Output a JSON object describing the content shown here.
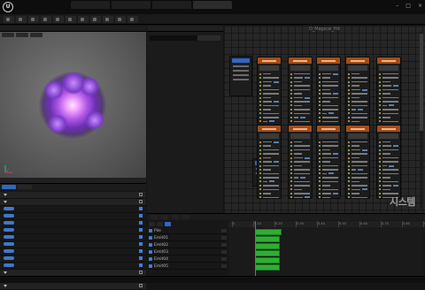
{
  "app": {
    "title": ""
  },
  "menu": {
    "items": [
      "",
      "",
      "",
      "",
      "",
      ""
    ]
  },
  "tabs": [
    {
      "label": "",
      "active": false
    },
    {
      "label": "",
      "active": false
    },
    {
      "label": "",
      "active": false
    },
    {
      "label": "",
      "active": true
    }
  ],
  "toolbar": {
    "buttons": [
      "",
      "",
      "",
      "",
      "",
      "",
      "",
      "",
      "",
      "",
      ""
    ]
  },
  "viewport": {
    "header": ""
  },
  "left_panel": {
    "tabs": [
      "",
      ""
    ],
    "rows": [
      {
        "name": "",
        "section": true,
        "pill": ""
      },
      {
        "name": "",
        "section": true,
        "pill": ""
      },
      {
        "name": "",
        "section": false,
        "pill": "#3f78c9",
        "checked": true
      },
      {
        "name": "",
        "section": false,
        "pill": "#3f78c9",
        "checked": true
      },
      {
        "name": "",
        "section": false,
        "pill": "#3f78c9",
        "checked": true
      },
      {
        "name": "",
        "section": false,
        "pill": "#3f78c9",
        "checked": true
      },
      {
        "name": "",
        "section": false,
        "pill": "#3f78c9",
        "checked": true
      },
      {
        "name": "",
        "section": false,
        "pill": "#3f78c9",
        "checked": true
      },
      {
        "name": "",
        "section": false,
        "pill": "#3f78c9",
        "checked": true
      },
      {
        "name": "",
        "section": false,
        "pill": "#3f78c9",
        "checked": true
      },
      {
        "name": "",
        "section": false,
        "pill": "#3f78c9",
        "checked": true
      },
      {
        "name": "",
        "section": true,
        "pill": ""
      },
      {
        "name": "",
        "section": true,
        "pill": ""
      },
      {
        "name": "",
        "section": true,
        "pill": ""
      }
    ]
  },
  "mid_panel": {
    "header": "",
    "search_button": "",
    "placeholder": ""
  },
  "graph": {
    "title": "D_Magical_Hit",
    "watermark": "시스템"
  },
  "bottom": {
    "tabs": [
      "",
      "",
      "",
      ""
    ],
    "tracks": [
      "Pile",
      "Emit01",
      "Emit02",
      "Emit03",
      "Emit04",
      "Emit05"
    ],
    "ruler_ticks": [
      "0",
      "0.10",
      "0.20",
      "0.30",
      "0.40",
      "0.50",
      "0.60",
      "0.70",
      "0.80",
      "0.90"
    ],
    "blocks": [
      "",
      "",
      "",
      "",
      "",
      ""
    ]
  },
  "status": {
    "items": [
      "",
      "",
      "",
      ""
    ]
  },
  "colors": {
    "accent": "#2f67c4",
    "node_header": "#a34d18",
    "timeline_block": "#2fae35",
    "playhead": "#d34e2a"
  }
}
